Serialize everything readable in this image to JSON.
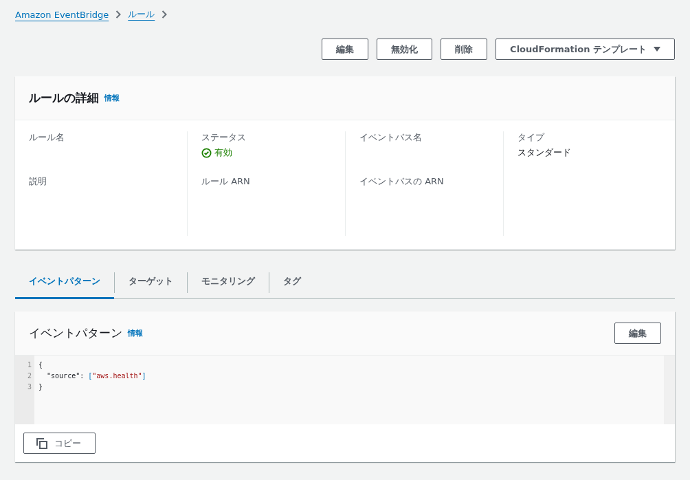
{
  "breadcrumbs": [
    {
      "label": "Amazon EventBridge"
    },
    {
      "label": "ルール"
    }
  ],
  "actions": [
    {
      "label": "編集",
      "kind": "plain"
    },
    {
      "label": "無効化",
      "kind": "plain"
    },
    {
      "label": "削除",
      "kind": "plain"
    },
    {
      "label": "CloudFormation テンプレート",
      "kind": "dropdown"
    }
  ],
  "details": {
    "title": "ルールの詳細",
    "info": "情報",
    "columns": [
      [
        {
          "label": "ルール名"
        },
        {
          "label": "説明"
        }
      ],
      [
        {
          "label": "ステータス",
          "value": "有効",
          "kind": "status"
        },
        {
          "label": "ルール ARN"
        }
      ],
      [
        {
          "label": "イベントバス名"
        },
        {
          "label": "イベントバスの ARN"
        }
      ],
      [
        {
          "label": "タイプ",
          "value": "スタンダード",
          "kind": "text"
        }
      ]
    ]
  },
  "tabs": [
    {
      "label": "イベントパターン",
      "selected": true
    },
    {
      "label": "ターゲット",
      "selected": false
    },
    {
      "label": "モニタリング",
      "selected": false
    },
    {
      "label": "タグ",
      "selected": false
    }
  ],
  "pattern": {
    "title": "イベントパターン",
    "info": "情報",
    "edit": "編集",
    "copy": "コピー",
    "lines": [
      {
        "number": "1",
        "tokens": [
          {
            "kind": "punct",
            "text": "{"
          }
        ]
      },
      {
        "number": "2",
        "tokens": [
          {
            "kind": "key",
            "text": "  \"source\""
          },
          {
            "kind": "plain",
            "text": ": "
          },
          {
            "kind": "bracket",
            "text": "["
          },
          {
            "kind": "string",
            "text": "\"aws.health\""
          },
          {
            "kind": "bracket",
            "text": "]"
          }
        ]
      },
      {
        "number": "3",
        "tokens": [
          {
            "kind": "punct",
            "text": "}"
          }
        ]
      }
    ]
  }
}
